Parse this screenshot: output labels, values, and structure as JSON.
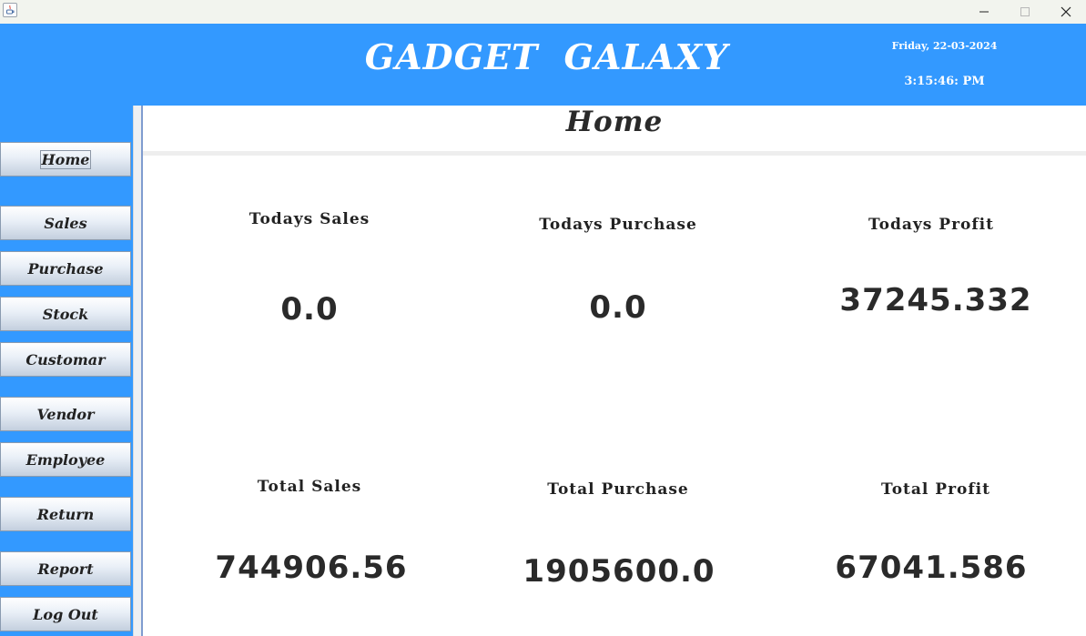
{
  "window": {
    "minimize_glyph": "—",
    "maximize_glyph": "☐",
    "close_glyph": "✕"
  },
  "header": {
    "app_title": "GADGET  GALAXY",
    "date": "Friday, 22-03-2024",
    "time": "3:15:46: PM"
  },
  "sidebar": {
    "items": [
      {
        "label": "Home",
        "active": true
      },
      {
        "label": "Sales"
      },
      {
        "label": "Purchase"
      },
      {
        "label": "Stock"
      },
      {
        "label": "Customar"
      },
      {
        "label": "Vendor"
      },
      {
        "label": "Employee"
      },
      {
        "label": "Return"
      },
      {
        "label": "Report"
      },
      {
        "label": "Log Out"
      }
    ]
  },
  "main": {
    "title": "Home",
    "today": {
      "sales_label": "Todays Sales",
      "sales_value": "0.0",
      "purchase_label": "Todays Purchase",
      "purchase_value": "0.0",
      "profit_label": "Todays Profit",
      "profit_value": "37245.332"
    },
    "total": {
      "sales_label": "Total Sales",
      "sales_value": "744906.56",
      "purchase_label": "Total Purchase",
      "purchase_value": "1905600.0",
      "profit_label": "Total Profit",
      "profit_value": "67041.586"
    }
  },
  "colors": {
    "accent": "#3399ff",
    "text": "#2a2a2a"
  },
  "icons": {
    "app": "java-cup-icon"
  }
}
